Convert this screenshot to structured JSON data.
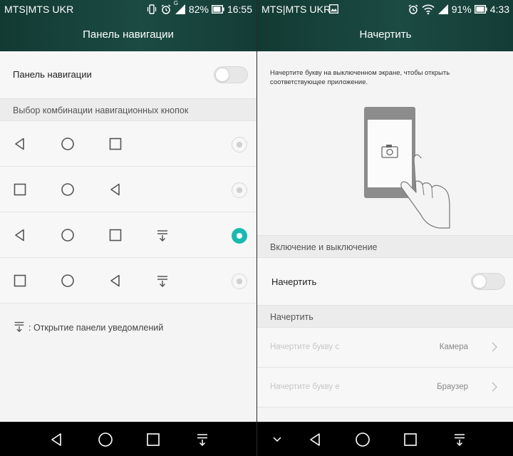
{
  "left": {
    "status": {
      "carrier": "MTS|MTS UKR",
      "battery": "82%",
      "time": "16:55",
      "signal_label": "G"
    },
    "title": "Панель навигации",
    "toggle_row": {
      "label": "Панель навигации",
      "state": "off"
    },
    "section_header": "Выбор комбинации навигационных кнопок",
    "combos": [
      {
        "icons": [
          "back-triangle-icon",
          "home-circle-icon",
          "recent-square-icon"
        ],
        "selected": false
      },
      {
        "icons": [
          "recent-square-icon",
          "home-circle-icon",
          "back-triangle-icon"
        ],
        "selected": false
      },
      {
        "icons": [
          "back-triangle-icon",
          "home-circle-icon",
          "recent-square-icon",
          "notification-pull-icon"
        ],
        "selected": true
      },
      {
        "icons": [
          "recent-square-icon",
          "home-circle-icon",
          "back-triangle-icon",
          "notification-pull-icon"
        ],
        "selected": false
      }
    ],
    "legend": ": Открытие панели уведомлений",
    "navbar": [
      "back-triangle-icon",
      "home-circle-icon",
      "recent-square-icon",
      "notification-pull-icon"
    ]
  },
  "right": {
    "status": {
      "carrier": "MTS|MTS UKR",
      "battery": "91%",
      "time": "4:33"
    },
    "title": "Начертить",
    "description": "Начертите букву на выключенном экране, чтобы открыть соответствующее приложение.",
    "section_power": "Включение и выключение",
    "draw_toggle": {
      "label": "Начертить",
      "state": "off"
    },
    "section_draw": "Начертить",
    "letters": [
      {
        "label": "Начертите букву c",
        "value": "Камера"
      },
      {
        "label": "Начертите букву e",
        "value": "Браузер"
      }
    ],
    "navbar": [
      "chevron-down-icon",
      "back-triangle-icon",
      "home-circle-icon",
      "recent-square-icon",
      "notification-pull-icon"
    ]
  },
  "colors": {
    "accent": "#1ab9b0",
    "titlebar": "#1b4b43",
    "navbar": "#000000",
    "background": "#f4f4f4"
  }
}
